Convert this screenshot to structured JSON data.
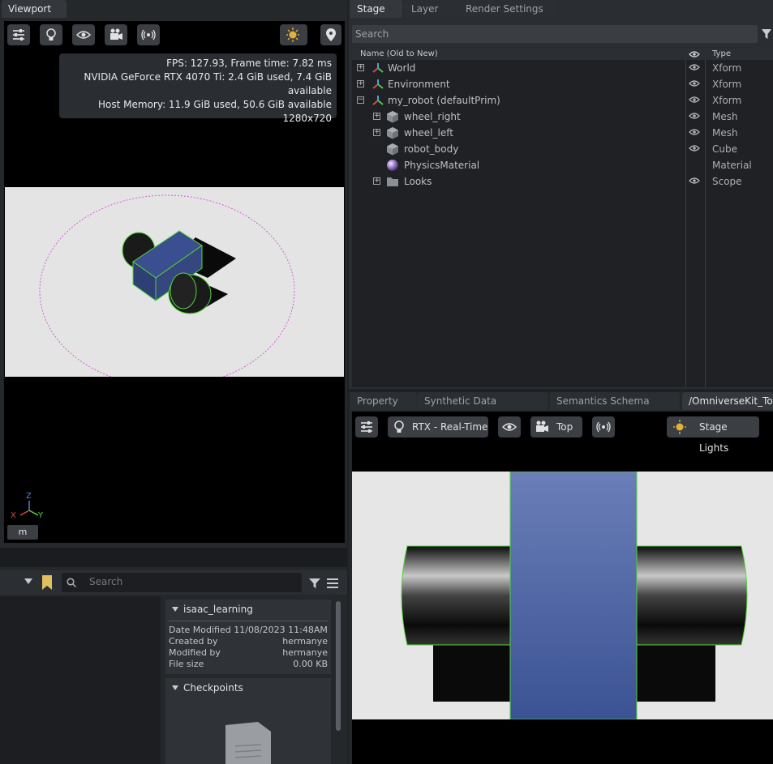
{
  "viewport": {
    "tab": "Viewport",
    "stats": [
      "FPS: 127.93, Frame time: 7.82 ms",
      "NVIDIA GeForce RTX 4070 Ti: 2.4 GiB used, 7.4 GiB available",
      "Host Memory: 11.9 GiB used, 50.6 GiB available",
      "1280x720"
    ],
    "axes": {
      "z": "Z",
      "x": "X",
      "y": "Y"
    },
    "unit": "m"
  },
  "stage": {
    "tabs": [
      "Stage",
      "Layer",
      "Render Settings"
    ],
    "search_placeholder": "Search",
    "col_name": "Name (Old to New)",
    "col_type": "Type",
    "rows": [
      {
        "name": "World",
        "type": "Xform"
      },
      {
        "name": "Environment",
        "type": "Xform"
      },
      {
        "name": "my_robot (defaultPrim)",
        "type": "Xform"
      },
      {
        "name": "wheel_right",
        "type": "Mesh"
      },
      {
        "name": "wheel_left",
        "type": "Mesh"
      },
      {
        "name": "robot_body",
        "type": "Cube"
      },
      {
        "name": "PhysicsMaterial",
        "type": "Material"
      },
      {
        "name": "Looks",
        "type": "Scope"
      }
    ]
  },
  "bottom_tabs": [
    "Property",
    "Synthetic Data Recorder",
    "Semantics Schema Editor",
    "/OmniverseKit_Top"
  ],
  "top_view": {
    "render_mode": "RTX - Real-Time",
    "camera": "Top",
    "lights": "Stage Lights"
  },
  "content": {
    "search_placeholder": "Search",
    "folder": "isaac_learning",
    "date_modified_label": "Date Modified",
    "date_modified": "11/08/2023 11:48AM",
    "created_by_label": "Created by",
    "created_by": "hermanye",
    "modified_by_label": "Modified by",
    "modified_by": "hermanye",
    "file_size_label": "File size",
    "file_size": "0.00 KB",
    "checkpoints": "Checkpoints"
  },
  "colors": {
    "accent_green": "#56d23a",
    "body_blue": "#3a4f8f",
    "bg": "#1f2124"
  }
}
